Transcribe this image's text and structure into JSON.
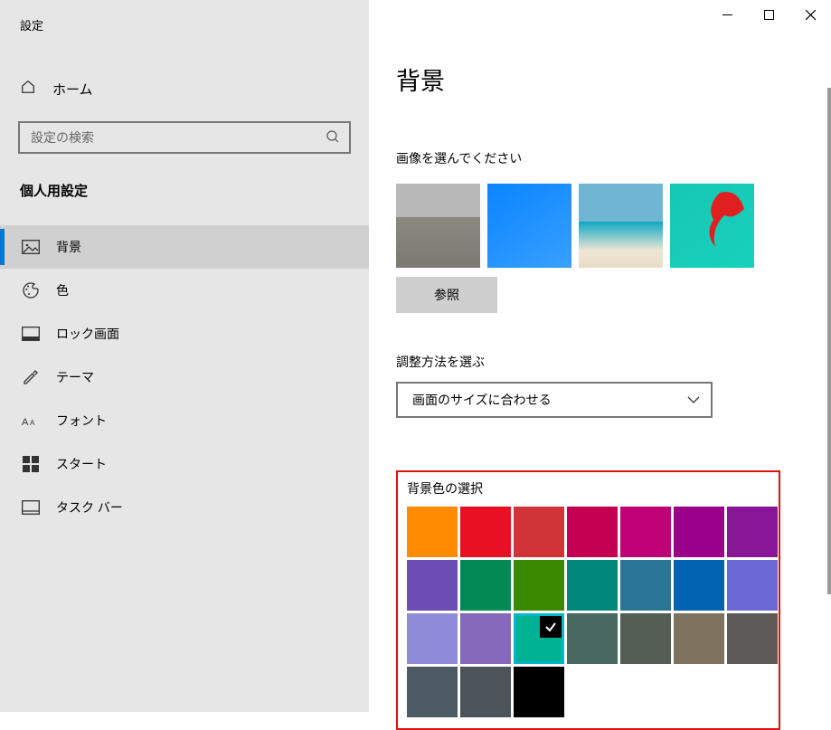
{
  "window": {
    "app_title": "設定"
  },
  "sidebar": {
    "home_label": "ホーム",
    "search_placeholder": "設定の検索",
    "section_title": "個人用設定",
    "items": [
      {
        "label": "背景",
        "icon": "image-icon",
        "active": true
      },
      {
        "label": "色",
        "icon": "palette-icon",
        "active": false
      },
      {
        "label": "ロック画面",
        "icon": "lockscreen-icon",
        "active": false
      },
      {
        "label": "テーマ",
        "icon": "theme-icon",
        "active": false
      },
      {
        "label": "フォント",
        "icon": "font-icon",
        "active": false
      },
      {
        "label": "スタート",
        "icon": "start-icon",
        "active": false
      },
      {
        "label": "タスク バー",
        "icon": "taskbar-icon",
        "active": false
      }
    ]
  },
  "main": {
    "page_title": "背景",
    "choose_image_label": "画像を選んでください",
    "browse_label": "参照",
    "fit_label": "調整方法を選ぶ",
    "fit_value": "画面のサイズに合わせる",
    "color_section_title": "背景色の選択",
    "colors": [
      "#ff8c00",
      "#e81123",
      "#d13438",
      "#c30052",
      "#bf0077",
      "#9a0089",
      "#881798",
      "#6b4db3",
      "#038a52",
      "#3a8a00",
      "#00877a",
      "#2b7599",
      "#0062b1",
      "#6b69d6",
      "#8e8cd8",
      "#8469bb",
      "#00b294",
      "#486860",
      "#525e54",
      "#7e735f",
      "#5d5a58",
      "#4c5b66",
      "#4a5459",
      "#000000"
    ],
    "selected_color_index": 16
  }
}
